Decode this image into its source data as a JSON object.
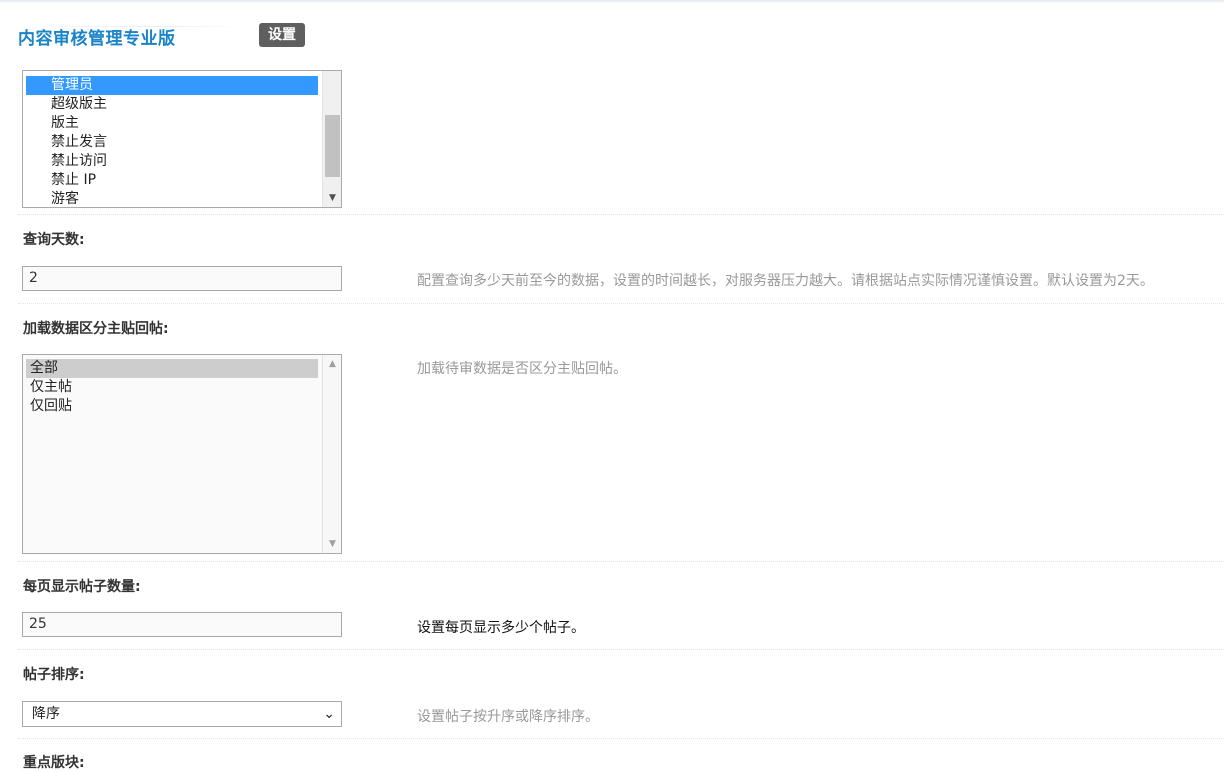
{
  "header": {
    "app_title": "内容审核管理专业版",
    "tab_settings": "设置"
  },
  "groups_list": {
    "items": [
      "管理员",
      "超级版主",
      "版主",
      "禁止发言",
      "禁止访问",
      "禁止 IP",
      "游客"
    ],
    "selected": "管理员"
  },
  "query_days": {
    "label": "查询天数:",
    "value": "2",
    "hint": "配置查询多少天前至今的数据，设置的时间越长，对服务器压力越大。请根据站点实际情况谨慎设置。默认设置为2天。"
  },
  "load_mode": {
    "label": "加载数据区分主贴回帖:",
    "options": [
      "全部",
      "仅主帖",
      "仅回贴"
    ],
    "selected": "全部",
    "hint": "加载待审数据是否区分主贴回帖。"
  },
  "per_page": {
    "label": "每页显示帖子数量:",
    "value": "25",
    "hint": "设置每页显示多少个帖子。"
  },
  "sort_order": {
    "label": "帖子排序:",
    "value": "降序",
    "hint": "设置帖子按升序或降序排序。"
  },
  "featured_forums": {
    "label": "重点版块:"
  }
}
